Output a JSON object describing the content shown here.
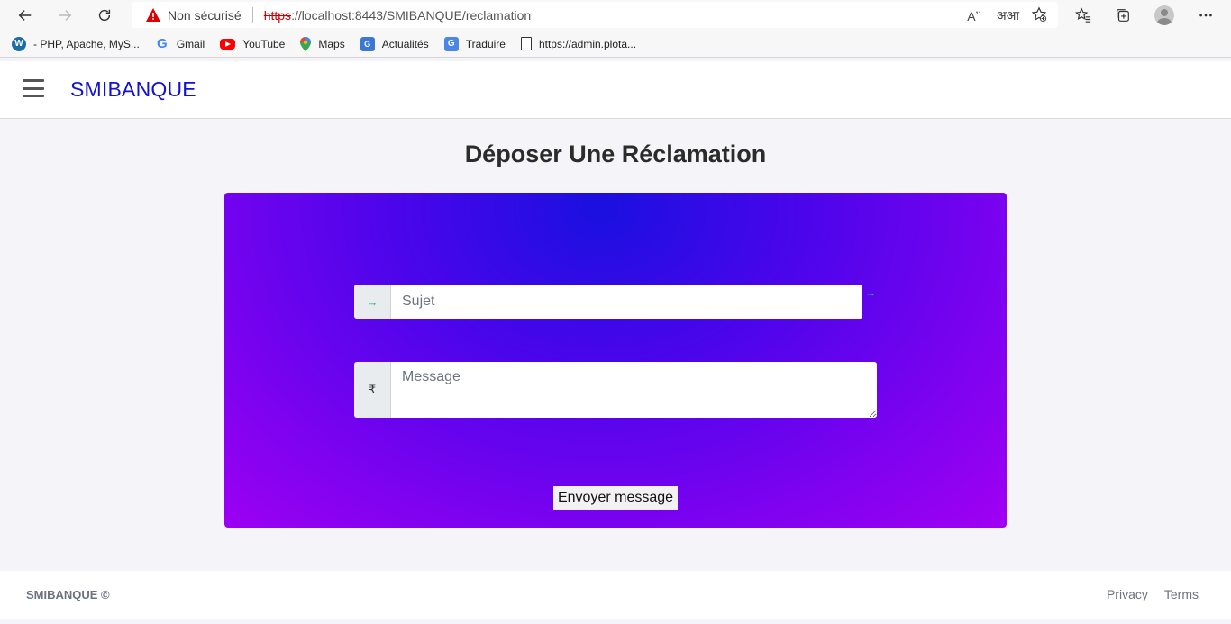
{
  "browser": {
    "security_label": "Non sécurisé",
    "url_scheme": "https",
    "url_rest": "://localhost:8443/SMIBANQUE/reclamation",
    "read_aloud_icon": "Aʼʼ",
    "translate_icon": "अआ"
  },
  "bookmarks": [
    {
      "label": "- PHP, Apache, MyS...",
      "icon": "wordpress-icon"
    },
    {
      "label": "Gmail",
      "icon": "google-icon"
    },
    {
      "label": "YouTube",
      "icon": "youtube-icon"
    },
    {
      "label": "Maps",
      "icon": "maps-icon"
    },
    {
      "label": "Actualités",
      "icon": "news-icon"
    },
    {
      "label": "Traduire",
      "icon": "translate-icon"
    },
    {
      "label": "https://admin.plota...",
      "icon": "document-icon"
    }
  ],
  "header": {
    "brand": "SMIBANQUE"
  },
  "main": {
    "title": "Déposer Une Réclamation",
    "subject_placeholder": "Sujet",
    "message_placeholder": "Message",
    "message_prefix": "₹",
    "submit_label": "Envoyer message"
  },
  "footer": {
    "copyright": "SMIBANQUE ©",
    "links": [
      "Privacy",
      "Terms"
    ]
  },
  "colors": {
    "brand": "#1010d6",
    "card_gradient_start": "#1a10e0",
    "card_gradient_end": "#a100f2",
    "accent_arrow": "#10b981"
  }
}
